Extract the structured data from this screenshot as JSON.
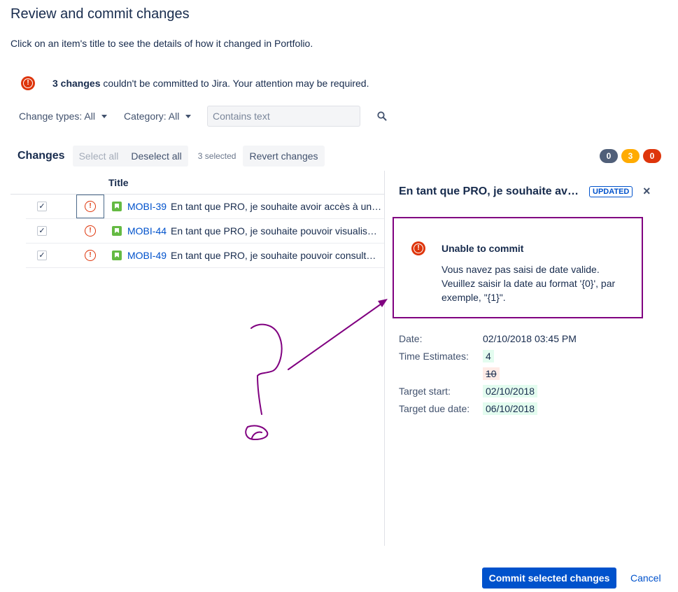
{
  "header": {
    "title": "Review and commit changes",
    "subtitle": "Click on an item's title to see the details of how it changed in Portfolio."
  },
  "warning": {
    "count_text": "3 changes",
    "message": " couldn't be committed to Jira. Your attention may be required."
  },
  "filters": {
    "change_types": "Change types: All",
    "category": "Category: All",
    "search_placeholder": "Contains text"
  },
  "changes_bar": {
    "label": "Changes",
    "select_all": "Select all",
    "deselect_all": "Deselect all",
    "selected_count": "3 selected",
    "revert": "Revert changes"
  },
  "badges": [
    {
      "value": "0",
      "color": "#505f79"
    },
    {
      "value": "3",
      "color": "#ffab00"
    },
    {
      "value": "0",
      "color": "#de350b"
    }
  ],
  "table": {
    "title_header": "Title",
    "rows": [
      {
        "checked": "✓",
        "key": "MOBI-39",
        "summary": "En tant que PRO, je souhaite avoir accès à un …"
      },
      {
        "checked": "✓",
        "key": "MOBI-44",
        "summary": "En tant que PRO, je souhaite pouvoir visualis…"
      },
      {
        "checked": "✓",
        "key": "MOBI-49",
        "summary": "En tant que PRO, je souhaite pouvoir consult…"
      }
    ]
  },
  "panel": {
    "title": "En tant que PRO, je souhaite av…",
    "lozenge": "UPDATED",
    "close": "×",
    "error": {
      "title": "Unable to commit",
      "message": "Vous navez pas saisi de date valide. Veuillez saisir la date au format '{0}', par exemple, \"{1}\"."
    },
    "details": {
      "date_label": "Date:",
      "date_value": "02/10/2018 03:45 PM",
      "time_label": "Time Estimates:",
      "time_new": "4",
      "time_old": "10",
      "start_label": "Target start:",
      "start_value": "02/10/2018",
      "due_label": "Target due date:",
      "due_value": "06/10/2018"
    }
  },
  "footer": {
    "commit": "Commit selected changes",
    "cancel": "Cancel"
  },
  "colors": {
    "primary": "#0052cc",
    "error": "#de350b",
    "annotation": "#800080"
  }
}
